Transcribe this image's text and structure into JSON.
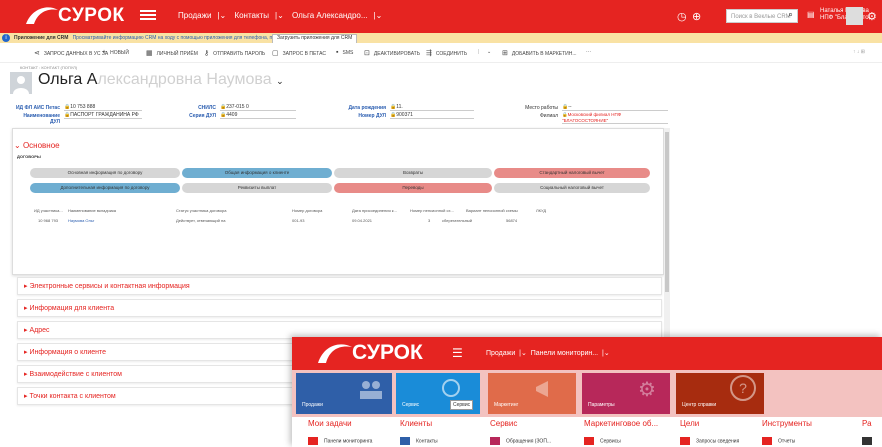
{
  "topbar": {
    "logo_text": "СУРОК",
    "nav": [
      "Продажи",
      "Контакты",
      "Ольга Александро..."
    ],
    "search_placeholder": "Поиск в Веклые CRM",
    "user_line1": "Наталья Евлоева",
    "user_line2": "НПФ \"Благососто..."
  },
  "notification": {
    "title": "Приложение для CRM",
    "text": "Просматривайте информацию CRM на ходу с помощью приложения для телефона, планшета, Outlook и не только",
    "button": "Загрузить приложения для CRM"
  },
  "commands": [
    "ЗАПРОС ДАННЫХ В УС ЗА",
    "НОВЫЙ",
    "ЛИЧНЫЙ ПРИЁМ",
    "ОТПРАВИТЬ ПАРОЛЬ",
    "ЗАПРОС В ПЕТАС",
    "SMS",
    "ДЕАКТИВИРОВАТЬ",
    "СОЕДИНИТЬ",
    "ДОБАВИТЬ В МАРКЕТИН...",
    "···"
  ],
  "header": {
    "breadcrumb": "КОНТАКТ : КОНТАКТ (ПОПУЛ)",
    "name_first": "Ольга А",
    "name_rest": "лександровна Наумова"
  },
  "fields": [
    {
      "label": "ИД ФЛ АИС Петас",
      "value": "10 753 888"
    },
    {
      "label": "Наименование ДУЛ",
      "value": "ПАСПОРТ ГРАЖДАНИНА РФ"
    },
    {
      "label": "СНИЛС",
      "value": "237-015 0"
    },
    {
      "label": "Серия ДУЛ",
      "value": "4409"
    },
    {
      "label": "Дата рождения",
      "value": "11."
    },
    {
      "label": "Номер ДУЛ",
      "value": "900371"
    },
    {
      "label": "Место работы",
      "value": "--"
    },
    {
      "label": "Филиал",
      "value": "Московский филиал НПФ \"БЛАГОСОСТОЯНИЕ\""
    }
  ],
  "main_section": {
    "title": "Основное",
    "subtitle": "ДОГОВОРЫ",
    "pills": [
      "Основная информация по договору",
      "Общая информация о клиенте",
      "Возвраты",
      "Стандартный налоговый вычет",
      "Дополнительная информация по договору",
      "Реквизиты выплат",
      "Переводы",
      "Социальный налоговый вычет"
    ],
    "table_headers": [
      "ИД участника...",
      "Наименование вкладчика",
      "Статус участника договора",
      "Номер договора",
      "Дата присоединения к...",
      "Номер пенсионной сх...",
      "Вариант пенсионной схемы",
      "ЛКУД"
    ],
    "table_row": [
      "10 968 793",
      "Наумова Ольг",
      "Действует, отвечающий на",
      "001-93",
      "09.04.2021",
      "3",
      "сберегательный",
      "56874"
    ]
  },
  "collapsed_sections": [
    "Электронные сервисы и контактная информация",
    "Информация для клиента",
    "Адрес",
    "Информация о клиенте",
    "Взаимодействие с клиентом",
    "Точки контакта с клиентом"
  ],
  "overlay": {
    "logo_text": "СУРОК",
    "nav": [
      "Продажи",
      "Панели мониторин..."
    ],
    "tiles": [
      "Продажи",
      "Сервис",
      "Сервис",
      "Маркетинг",
      "Параметры",
      "Центр справки"
    ],
    "columns": [
      "Мои задачи",
      "Клиенты",
      "Сервис",
      "Маркетинговое об...",
      "Цели",
      "Инструменты",
      "Ра"
    ],
    "items": [
      "Панели мониторинга",
      "Контакты",
      "Обращения (ЗОП...",
      "Сервисы",
      "Запросы сведения",
      "Отчеты"
    ]
  },
  "colors": {
    "brand_red": "#e52421",
    "pill_blue": "#6faed1",
    "pill_red": "#e88b88",
    "pill_gray": "#d6d6d6"
  }
}
